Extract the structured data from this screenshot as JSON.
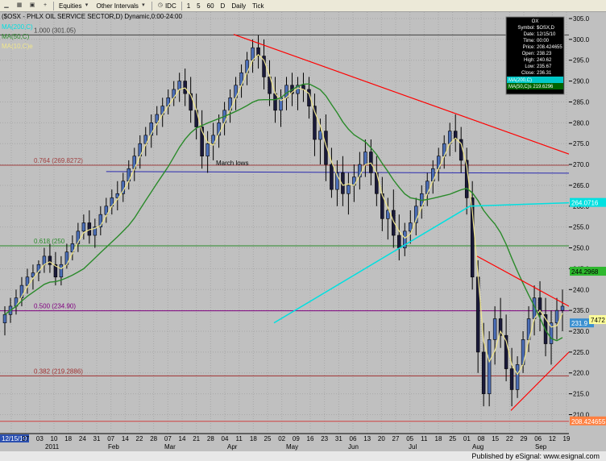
{
  "toolbar": {
    "items": [
      {
        "label": "",
        "icon": "minimize-icon"
      },
      {
        "label": "",
        "icon": "grid-icon"
      },
      {
        "label": "",
        "icon": "save-icon"
      },
      {
        "label": "",
        "icon": "plus-icon"
      },
      {
        "label": "Equities",
        "icon": "chevron-down-icon"
      },
      {
        "label": "Other Intervals",
        "icon": "chevron-down-icon"
      },
      {
        "label": "IDC",
        "icon": "clock-icon"
      },
      {
        "label": "1"
      },
      {
        "label": "5"
      },
      {
        "label": "60"
      },
      {
        "label": "D"
      },
      {
        "label": "Daily"
      },
      {
        "label": "Tick"
      }
    ]
  },
  "chart_data": {
    "type": "candlestick",
    "title": "($OSX - PHLX OIL SERVICE SECTOR,D) Dynamic,0:00-24:00",
    "ylim": [
      207,
      305
    ],
    "yticks": [
      210,
      215,
      220,
      225,
      230,
      235,
      240,
      245,
      250,
      255,
      260,
      265,
      270,
      275,
      280,
      285,
      290,
      295,
      300,
      305
    ],
    "xaxis": {
      "dates": [
        "12/15/10",
        "27",
        "03",
        "10",
        "18",
        "24",
        "31",
        "07",
        "14",
        "22",
        "28",
        "07",
        "14",
        "21",
        "28",
        "04",
        "11",
        "18",
        "25",
        "02",
        "09",
        "16",
        "23",
        "31",
        "06",
        "13",
        "20",
        "27",
        "05",
        "11",
        "18",
        "25",
        "01",
        "08",
        "15",
        "22",
        "29",
        "06",
        "12",
        "19"
      ],
      "months": [
        "2011",
        "Feb",
        "Mar",
        "Apr",
        "May",
        "Jun",
        "Jul",
        "Aug",
        "Sep"
      ]
    },
    "fib_levels": [
      {
        "label": "1.000 (301.05)",
        "value": 301.05,
        "color": "#404040"
      },
      {
        "label": "0.764 (269.8272)",
        "value": 269.8272,
        "color": "#a04040"
      },
      {
        "label": "0.618 (250",
        "value": 250.5,
        "color": "#2a8a2a"
      },
      {
        "label": "0.500 (234.90)",
        "value": 234.9,
        "color": "#800080"
      },
      {
        "label": "0.382 (219.2886)",
        "value": 219.2886,
        "color": "#a03030"
      }
    ],
    "fib_bottom": 208.4,
    "annotation": "March lows",
    "march_lows_value": 268.3,
    "last_price": "208.424655",
    "price_labels": [
      {
        "text": "244.2968",
        "value": 244.3,
        "bg": "#2eb82e",
        "fg": "#000000"
      },
      {
        "text": "231.9",
        "value": 231.9,
        "bg": "#3a8fd0",
        "fg": "#ffffff"
      },
      {
        "text": "7472",
        "value": 232.7,
        "bg": "#ffff99",
        "fg": "#000000"
      },
      {
        "text": "264.0716",
        "value": 260.8,
        "bg": "#00e0e0",
        "fg": "#ffffff"
      },
      {
        "text": "208.424655",
        "value": 208.4,
        "bg": "#ff8040",
        "fg": "#ffffff"
      }
    ],
    "legend": [
      {
        "text": "MA(200,C)",
        "color": "#00e0e0"
      },
      {
        "text": "MA(50,C)",
        "color": "#2a8a2a"
      },
      {
        "text": "MA(10,C)e",
        "color": "#f0e68c"
      }
    ],
    "candles": [
      [
        232,
        236,
        229,
        234
      ],
      [
        234,
        238,
        232,
        236
      ],
      [
        236,
        240,
        234,
        238
      ],
      [
        238,
        243,
        236,
        241
      ],
      [
        241,
        245,
        239,
        243
      ],
      [
        243,
        246,
        240,
        244
      ],
      [
        244,
        247,
        242,
        246
      ],
      [
        246,
        250,
        244,
        248
      ],
      [
        248,
        251,
        244,
        246
      ],
      [
        246,
        249,
        241,
        243
      ],
      [
        243,
        248,
        241,
        246
      ],
      [
        246,
        251,
        245,
        249
      ],
      [
        249,
        253,
        247,
        251
      ],
      [
        251,
        256,
        249,
        254
      ],
      [
        254,
        258,
        252,
        256
      ],
      [
        256,
        259,
        251,
        253
      ],
      [
        253,
        257,
        250,
        255
      ],
      [
        255,
        260,
        253,
        258
      ],
      [
        258,
        262,
        256,
        260
      ],
      [
        260,
        264,
        258,
        262
      ],
      [
        262,
        266,
        259,
        263
      ],
      [
        263,
        268,
        261,
        266
      ],
      [
        266,
        271,
        264,
        269
      ],
      [
        269,
        274,
        266,
        272
      ],
      [
        272,
        277,
        269,
        275
      ],
      [
        275,
        279,
        272,
        277
      ],
      [
        277,
        282,
        274,
        280
      ],
      [
        280,
        284,
        277,
        282
      ],
      [
        282,
        286,
        279,
        284
      ],
      [
        284,
        288,
        282,
        286
      ],
      [
        286,
        290,
        284,
        288
      ],
      [
        288,
        292,
        285,
        290
      ],
      [
        290,
        293,
        284,
        287
      ],
      [
        287,
        291,
        280,
        283
      ],
      [
        283,
        287,
        276,
        279
      ],
      [
        279,
        283,
        269,
        272
      ],
      [
        272,
        278,
        268,
        275
      ],
      [
        275,
        280,
        271,
        277
      ],
      [
        277,
        282,
        274,
        280
      ],
      [
        280,
        285,
        277,
        283
      ],
      [
        283,
        288,
        280,
        286
      ],
      [
        286,
        291,
        283,
        289
      ],
      [
        289,
        294,
        286,
        292
      ],
      [
        292,
        297,
        289,
        295
      ],
      [
        295,
        300,
        292,
        298
      ],
      [
        298,
        301,
        293,
        296
      ],
      [
        296,
        300,
        288,
        291
      ],
      [
        291,
        295,
        284,
        287
      ],
      [
        287,
        291,
        280,
        283
      ],
      [
        283,
        288,
        279,
        286
      ],
      [
        286,
        291,
        283,
        289
      ],
      [
        289,
        292,
        284,
        287
      ],
      [
        287,
        291,
        283,
        289
      ],
      [
        289,
        292,
        285,
        288
      ],
      [
        288,
        291,
        281,
        284
      ],
      [
        284,
        287,
        272,
        276
      ],
      [
        276,
        281,
        270,
        278
      ],
      [
        278,
        282,
        266,
        270
      ],
      [
        270,
        274,
        262,
        264
      ],
      [
        264,
        271,
        260,
        268
      ],
      [
        268,
        272,
        260,
        263
      ],
      [
        263,
        268,
        258,
        265
      ],
      [
        265,
        270,
        261,
        267
      ],
      [
        267,
        273,
        264,
        270
      ],
      [
        270,
        276,
        267,
        273
      ],
      [
        273,
        276,
        265,
        268
      ],
      [
        268,
        272,
        260,
        263
      ],
      [
        263,
        267,
        254,
        257
      ],
      [
        257,
        262,
        252,
        259
      ],
      [
        259,
        264,
        250,
        253
      ],
      [
        253,
        258,
        247,
        250
      ],
      [
        250,
        256,
        248,
        254
      ],
      [
        254,
        259,
        251,
        256
      ],
      [
        256,
        262,
        253,
        260
      ],
      [
        260,
        265,
        257,
        263
      ],
      [
        263,
        268,
        260,
        266
      ],
      [
        266,
        271,
        263,
        269
      ],
      [
        269,
        274,
        266,
        272
      ],
      [
        272,
        277,
        269,
        275
      ],
      [
        275,
        280,
        272,
        278
      ],
      [
        278,
        282,
        273,
        276
      ],
      [
        276,
        279,
        268,
        271
      ],
      [
        271,
        274,
        258,
        262
      ],
      [
        262,
        266,
        240,
        243
      ],
      [
        243,
        247,
        220,
        225
      ],
      [
        225,
        232,
        212,
        215
      ],
      [
        215,
        230,
        212,
        228
      ],
      [
        228,
        236,
        222,
        233
      ],
      [
        233,
        238,
        226,
        229
      ],
      [
        229,
        234,
        218,
        221
      ],
      [
        221,
        226,
        212,
        216
      ],
      [
        216,
        224,
        214,
        222
      ],
      [
        222,
        230,
        220,
        228
      ],
      [
        228,
        236,
        225,
        233
      ],
      [
        233,
        241,
        229,
        238
      ],
      [
        238,
        242,
        230,
        234
      ],
      [
        234,
        238,
        224,
        227
      ],
      [
        227,
        235,
        222,
        232
      ],
      [
        232,
        238,
        228,
        235
      ],
      [
        235,
        240,
        230,
        236
      ]
    ],
    "ma10": [],
    "ma50": [],
    "ma200": []
  },
  "footer": {
    "text": "Published by eSignal: www.esignal.com"
  },
  "data_window": {
    "title": "OX",
    "rows": [
      {
        "label": "Symbol",
        "value": "$OSX,D"
      },
      {
        "label": "Date",
        "value": "12/15/10"
      },
      {
        "label": "Time",
        "value": "00:00"
      },
      {
        "label": "Price",
        "value": "208.424655"
      },
      {
        "label": "Open",
        "value": "238.23"
      },
      {
        "label": "High",
        "value": "240.62"
      },
      {
        "label": "Low",
        "value": "235.67"
      },
      {
        "label": "Close",
        "value": "236.31"
      }
    ],
    "ma_rows": [
      {
        "text": "MA(200,C)",
        "bg": "#00c8c8"
      },
      {
        "text": "MA(50,C)s 219.6296",
        "bg": "#006400"
      }
    ]
  }
}
